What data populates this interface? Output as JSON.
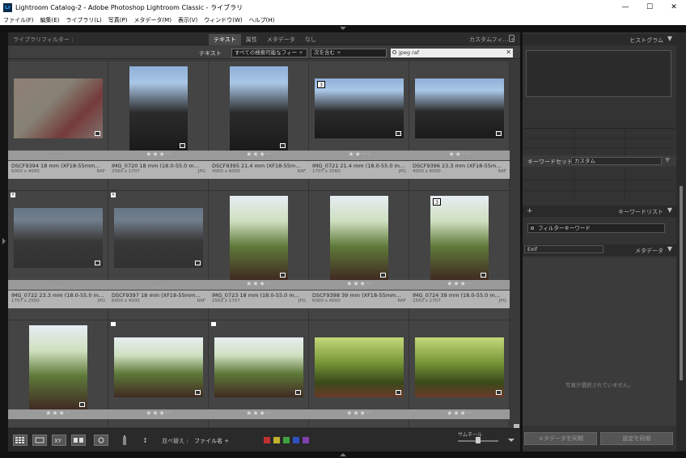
{
  "window": {
    "app_icon": "Lr",
    "title": "Lightroom Catalog-2 - Adobe Photoshop Lightroom Classic - ライブラリ",
    "controls": [
      "—",
      "☐",
      "✕"
    ]
  },
  "menu": [
    "ファイル(F)",
    "編集(E)",
    "ライブラリ(L)",
    "写真(P)",
    "メタデータ(M)",
    "表示(V)",
    "ウィンドウ(W)",
    "ヘルプ(H)"
  ],
  "filter_bar": {
    "title": "ライブラリフィルター :",
    "tabs": [
      "テキスト",
      "属性",
      "メタデータ",
      "なし"
    ],
    "active_tab": "テキスト",
    "preset": "カスタムフィ… ÷"
  },
  "text_filter": {
    "label": "テキスト",
    "field": "すべての検索可能なフィー ÷",
    "rule": "次を含む ÷",
    "search_value": "jpeg raf"
  },
  "photos": [
    {
      "name": "DSCF9394",
      "info": "18 mm (XF18-55mm…",
      "dims": "6000 x 4000",
      "type": "RAF",
      "stars": "·····",
      "rated": false,
      "photo": "papers",
      "orient": "land",
      "dimmed": true
    },
    {
      "name": "IMG_0720",
      "info": "18 mm (18.0-55.0 m…",
      "dims": "2560 x 1707",
      "type": "JPG",
      "stars": "★★★··",
      "rated": true,
      "photo": "temple",
      "orient": "port"
    },
    {
      "name": "DSCF9395",
      "info": "21.4 mm (XF18-55m…",
      "dims": "4000 x 6000",
      "type": "RAF",
      "stars": "★★★··",
      "rated": true,
      "photo": "temple",
      "orient": "port"
    },
    {
      "name": "IMG_0721",
      "info": "21.4 mm (18.0-55.0 m…",
      "dims": "1707 x 2560",
      "type": "JPG",
      "stars": "★★···",
      "rated": true,
      "photo": "temple",
      "orient": "land",
      "badge": "3"
    },
    {
      "name": "DSCF9396",
      "info": "23.3 mm (XF18-55m…",
      "dims": "4000 x 6000",
      "type": "RAF",
      "stars": "★★···",
      "rated": true,
      "photo": "temple",
      "orient": "land"
    },
    {
      "name": "IMG_0722",
      "info": "23.3 mm (18.0-55.0 m…",
      "dims": "1707 x 2560",
      "type": "JPG",
      "stars": "·····",
      "rated": false,
      "photo": "temple",
      "orient": "land",
      "dimmed": true,
      "xflag": "✕"
    },
    {
      "name": "DSCF9397",
      "info": "18 mm (XF18-55mm…",
      "dims": "6000 x 4000",
      "type": "RAF",
      "stars": "·····",
      "rated": false,
      "photo": "temple",
      "orient": "land",
      "dimmed": true,
      "xflag": "✕"
    },
    {
      "name": "IMG_0723",
      "info": "18 mm (18.0-55.0 m…",
      "dims": "2560 x 1707",
      "type": "JPG",
      "stars": "★★★··",
      "rated": true,
      "photo": "pagoda",
      "orient": "port"
    },
    {
      "name": "DSCF9398",
      "info": "39 mm (XF18-55mm…",
      "dims": "6000 x 4000",
      "type": "RAF",
      "stars": "★★★··",
      "rated": true,
      "photo": "pagoda",
      "orient": "port"
    },
    {
      "name": "IMG_0724",
      "info": "39 mm (18.0-55.0 m…",
      "dims": "2560 x 1707",
      "type": "JPG",
      "stars": "★★★··",
      "rated": true,
      "photo": "pagoda",
      "orient": "port",
      "badge": "3"
    },
    {
      "name": "",
      "info": "",
      "dims": "",
      "type": "",
      "stars": "★★★··",
      "rated": true,
      "photo": "pagoda",
      "orient": "port"
    },
    {
      "name": "",
      "info": "",
      "dims": "",
      "type": "",
      "stars": "★★★··",
      "rated": true,
      "photo": "pagoda",
      "orient": "land",
      "flag": true
    },
    {
      "name": "",
      "info": "",
      "dims": "",
      "type": "",
      "stars": "★★★··",
      "rated": true,
      "photo": "pagoda",
      "orient": "land",
      "flag": true
    },
    {
      "name": "",
      "info": "",
      "dims": "",
      "type": "",
      "stars": "★★★··",
      "rated": true,
      "photo": "trees",
      "orient": "land"
    },
    {
      "name": "",
      "info": "",
      "dims": "",
      "type": "",
      "stars": "★★★··",
      "rated": true,
      "photo": "trees",
      "orient": "land"
    }
  ],
  "toolbar": {
    "sort_label": "並べ替え :",
    "sort_value": "ファイル名 ÷",
    "thumb_label": "サムネール",
    "colors": [
      "#c03030",
      "#c0b030",
      "#40a040",
      "#3050c0",
      "#8040b0"
    ]
  },
  "right_panel": {
    "histogram_title": "ヒストグラム",
    "keyword_set_label": "キーワードセット",
    "keyword_set_value": "カスタム",
    "keyword_list_title": "キーワードリスト",
    "add_label": "+",
    "filter_keywords_placeholder": "フィルターキーワード",
    "exif_value": "Exif",
    "metadata_title": "メタデータ",
    "no_photo_text": "写真が選択されていません。",
    "sync_metadata": "メタデータを同期",
    "sync_settings": "設定を同期"
  }
}
